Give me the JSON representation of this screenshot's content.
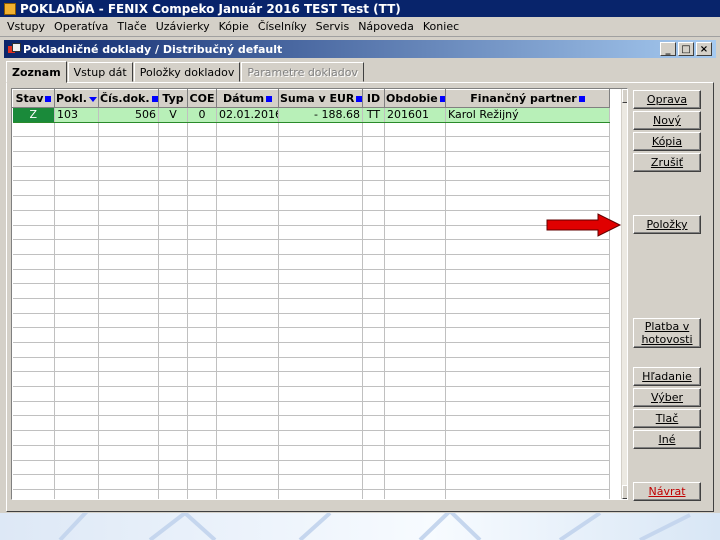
{
  "window": {
    "title": "POKLADŇA - FENIX Compeko  Január 2016  TEST Test  (TT)"
  },
  "menu": [
    "Vstupy",
    "Operatíva",
    "Tlače",
    "Uzávierky",
    "Kópie",
    "Číselníky",
    "Servis",
    "Nápoveda",
    "Koniec"
  ],
  "child_window": {
    "title": "Pokladničné doklady / Distribučný default",
    "buttons": {
      "minimize": "_",
      "restore": "□",
      "close": "×"
    }
  },
  "tabs": [
    {
      "label": "Zoznam",
      "state": "active"
    },
    {
      "label": "Vstup dát",
      "state": "normal"
    },
    {
      "label": "Položky dokladov",
      "state": "normal"
    },
    {
      "label": "Parametre dokladov",
      "state": "disabled"
    }
  ],
  "grid": {
    "columns": [
      "Stav",
      "Pokl.",
      "Čís.dok.",
      "Typ",
      "COE",
      "Dátum",
      "Suma v EUR",
      "ID",
      "Obdobie",
      "Finančný partner"
    ],
    "rows": [
      [
        "Z",
        "103",
        "506",
        "V",
        "0",
        "02.01.2016",
        "- 188.68",
        "TT",
        "201601",
        "Karol Režijný"
      ]
    ]
  },
  "side_buttons": {
    "oprava": "Oprava",
    "novy": "Nový",
    "kopia": "Kópia",
    "zrusit": "Zrušiť",
    "polozky": "Položky",
    "platba": "Platba v hotovosti",
    "hladanie": "Hľadanie",
    "vyber": "Výber",
    "tlac": "Tlač",
    "ine": "Iné",
    "navrat": "Návrat"
  },
  "colors": {
    "title_bar": "#08246b",
    "selected_row": "#b8f0b8",
    "status_cell": "#1a8a3a",
    "sort_marker": "#0000ff",
    "arrow": "#e00000",
    "return_button_text": "#c00000"
  },
  "icons": {
    "app": "pokladna-app-icon",
    "child": "documents-icon",
    "annotation": "red-arrow-pointing-right"
  }
}
